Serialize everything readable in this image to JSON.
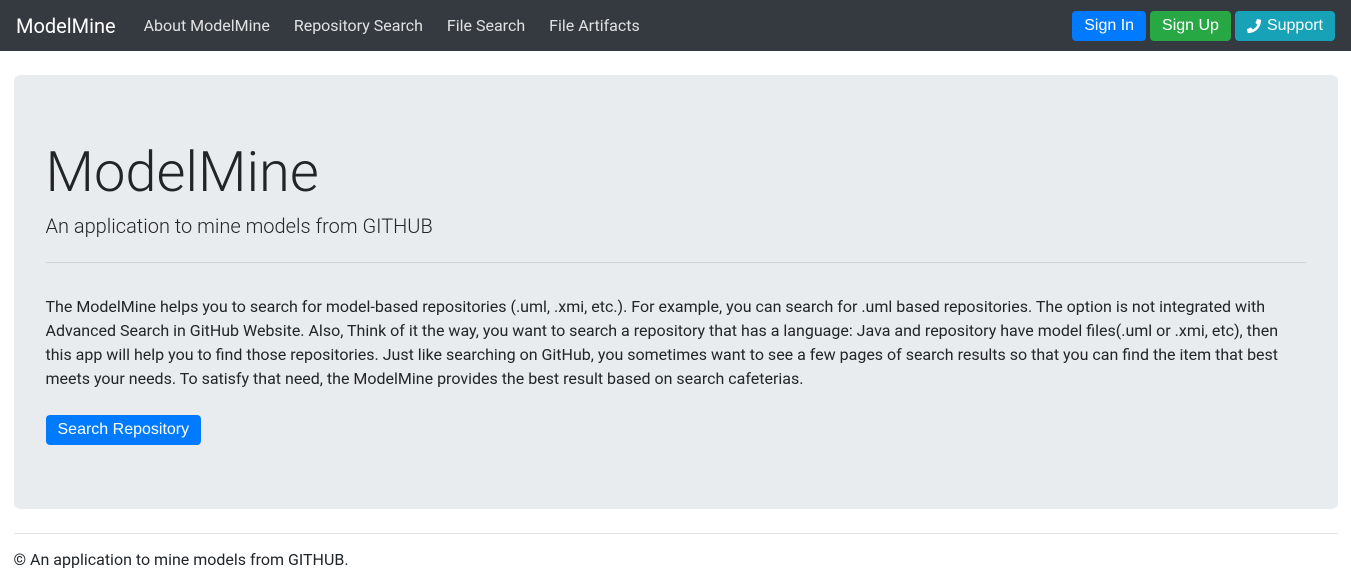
{
  "navbar": {
    "brand": "ModelMine",
    "links": {
      "about": "About ModelMine",
      "repoSearch": "Repository Search",
      "fileSearch": "File Search",
      "fileArtifacts": "File Artifacts"
    },
    "buttons": {
      "signIn": "Sign In",
      "signUp": "Sign Up",
      "support": "Support"
    }
  },
  "hero": {
    "title": "ModelMine",
    "subtitle": "An application to mine models from GITHUB",
    "description": "The ModelMine helps you to search for model-based repositories (.uml, .xmi, etc.). For example, you can search for .uml based repositories. The option is not integrated with Advanced Search in GitHub Website. Also, Think of it the way, you want to search a repository that has a language: Java and repository have model files(.uml or .xmi, etc), then this app will help you to find those repositories. Just like searching on GitHub, you sometimes want to see a few pages of search results so that you can find the item that best meets your needs. To satisfy that need, the ModelMine provides the best result based on search cafeterias.",
    "cta": "Search Repository"
  },
  "footer": {
    "copyright": "© An application to mine models from GITHUB."
  }
}
